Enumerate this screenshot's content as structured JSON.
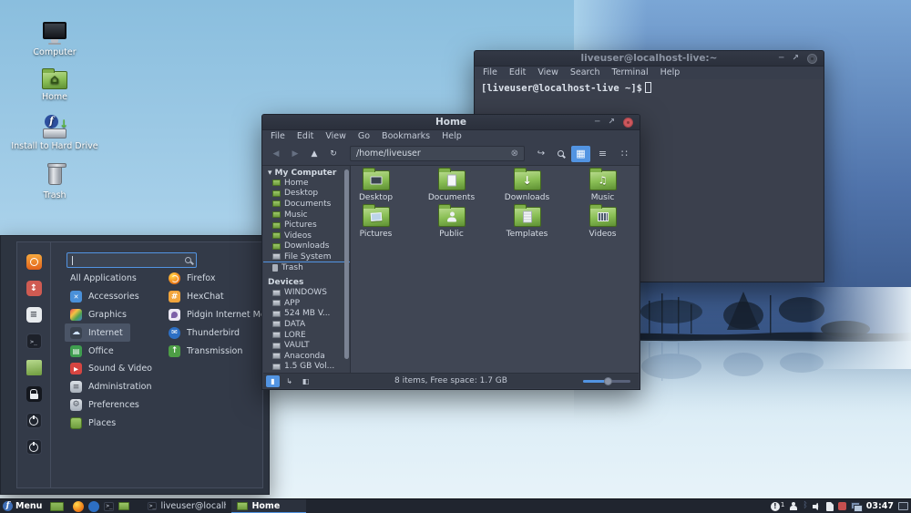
{
  "desktop": {
    "icons": [
      {
        "label": "Computer"
      },
      {
        "label": "Home"
      },
      {
        "label": "Install to Hard Drive"
      },
      {
        "label": "Trash"
      }
    ]
  },
  "terminal": {
    "title": "liveuser@localhost-live:~",
    "menu": [
      "File",
      "Edit",
      "View",
      "Search",
      "Terminal",
      "Help"
    ],
    "prompt": "[liveuser@localhost-live ~]$"
  },
  "filemanager": {
    "title": "Home",
    "menu": [
      "File",
      "Edit",
      "View",
      "Go",
      "Bookmarks",
      "Help"
    ],
    "path": "/home/liveuser",
    "sidebar": {
      "my_computer": "My Computer",
      "places": [
        "Home",
        "Desktop",
        "Documents",
        "Music",
        "Pictures",
        "Videos",
        "Downloads",
        "File System",
        "Trash"
      ],
      "devices_label": "Devices",
      "devices": [
        "WINDOWS",
        "APP",
        "524 MB V...",
        "DATA",
        "LORE",
        "VAULT",
        "Anaconda",
        "1.5 GB Vol..."
      ]
    },
    "folders": [
      "Desktop",
      "Documents",
      "Downloads",
      "Music",
      "Pictures",
      "Public",
      "Templates",
      "Videos"
    ],
    "status": "8 items, Free space: 1.7 GB"
  },
  "appmenu": {
    "categories": [
      "All Applications",
      "Accessories",
      "Graphics",
      "Internet",
      "Office",
      "Sound & Video",
      "Administration",
      "Preferences",
      "Places"
    ],
    "apps": [
      "Firefox",
      "HexChat",
      "Pidgin Internet Messenger",
      "Thunderbird",
      "Transmission"
    ]
  },
  "taskbar": {
    "menu": "Menu",
    "tasks": [
      "liveuser@localh...",
      "Home"
    ],
    "clock": "03:47",
    "notification_count": "1"
  },
  "colors": {
    "accent": "#5294e2",
    "close_button": "#cc575d",
    "folder_green": "#8abf55",
    "titlebar": "#2f3440"
  }
}
